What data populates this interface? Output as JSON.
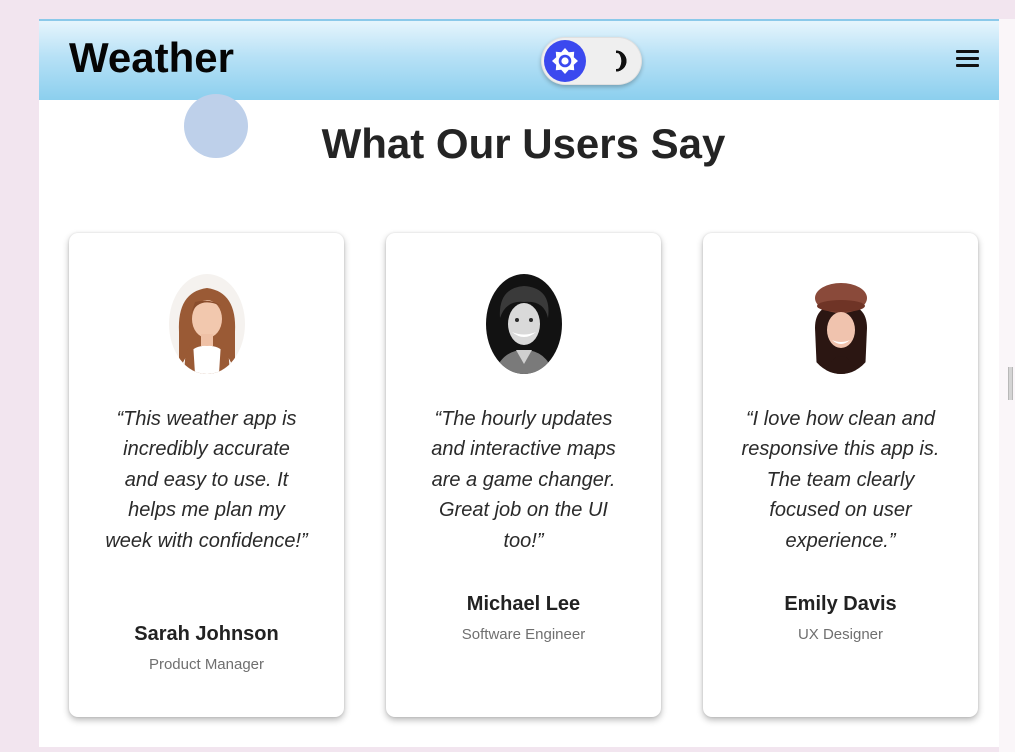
{
  "header": {
    "brand": "Weather",
    "theme_toggle": {
      "mode": "light",
      "sun_icon": "sun-icon",
      "moon_icon": "moon-icon"
    },
    "menu_icon": "hamburger-menu-icon"
  },
  "section": {
    "title": "What Our Users Say"
  },
  "testimonials": [
    {
      "quote": "“This weather app is incredibly accurate and easy to use. It helps me plan my week with confidence!”",
      "name": "Sarah Johnson",
      "role": "Product Manager"
    },
    {
      "quote": "“The hourly updates and interactive maps are a game changer. Great job on the UI too!”",
      "name": "Michael Lee",
      "role": "Software Engineer"
    },
    {
      "quote": "“I love how clean and responsive this app is. The team clearly focused on user experience.”",
      "name": "Emily Davis",
      "role": "UX Designer"
    }
  ],
  "colors": {
    "header_top": "#e6f5fd",
    "header_bottom": "#8ccfee",
    "toggle_knob": "#3b49ef",
    "title_text": "#242424",
    "outer_background": "#f2e5ef"
  }
}
